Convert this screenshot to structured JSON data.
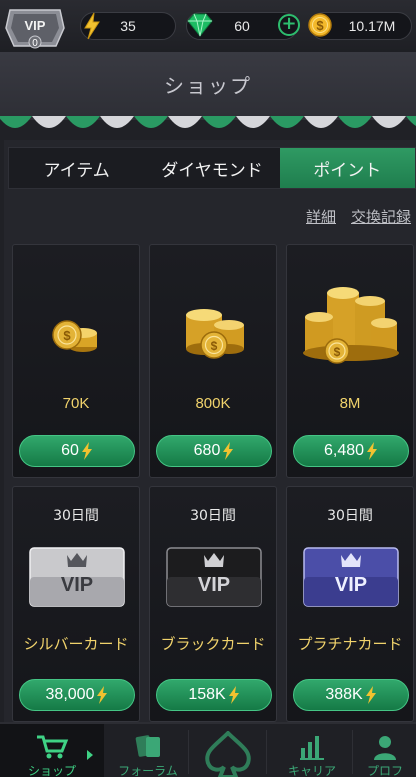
{
  "header": {
    "vip_badge": "VIP",
    "vip_level": "0",
    "energy": "35",
    "gems": "60",
    "coins": "10.17M"
  },
  "title": "ショップ",
  "tabs": [
    {
      "label": "アイテム",
      "active": false
    },
    {
      "label": "ダイヤモンド",
      "active": false
    },
    {
      "label": "ポイント",
      "active": true
    }
  ],
  "links": {
    "detail": "詳細",
    "history": "交換記録"
  },
  "coin_packs": [
    {
      "amount": "70K",
      "price": "60",
      "icon": "coin-stack-small-icon"
    },
    {
      "amount": "800K",
      "price": "680",
      "icon": "coin-stack-medium-icon"
    },
    {
      "amount": "8M",
      "price": "6,480",
      "icon": "coin-stack-large-icon"
    }
  ],
  "vip_cards": [
    {
      "duration": "30日間",
      "name": "シルバーカード",
      "price": "38,000",
      "card_label": "VIP",
      "color": "#c9c9cc"
    },
    {
      "duration": "30日間",
      "name": "ブラックカード",
      "price": "158K",
      "card_label": "VIP",
      "color": "#1c1c1e"
    },
    {
      "duration": "30日間",
      "name": "プラチナカード",
      "price": "388K",
      "card_label": "VIP",
      "color": "#4b4ea8"
    }
  ],
  "nav": [
    {
      "label": "ショップ",
      "icon": "cart-icon",
      "active": true
    },
    {
      "label": "フォーラム",
      "icon": "cards-icon",
      "active": false
    },
    {
      "label": "",
      "icon": "spade-logo-icon",
      "active": false
    },
    {
      "label": "キャリア",
      "icon": "bar-chart-icon",
      "active": false
    },
    {
      "label": "プロフ",
      "icon": "person-icon",
      "active": false
    }
  ],
  "colors": {
    "accent_green": "#2dbd6e",
    "gold": "#f1d36c",
    "background": "#202126"
  }
}
